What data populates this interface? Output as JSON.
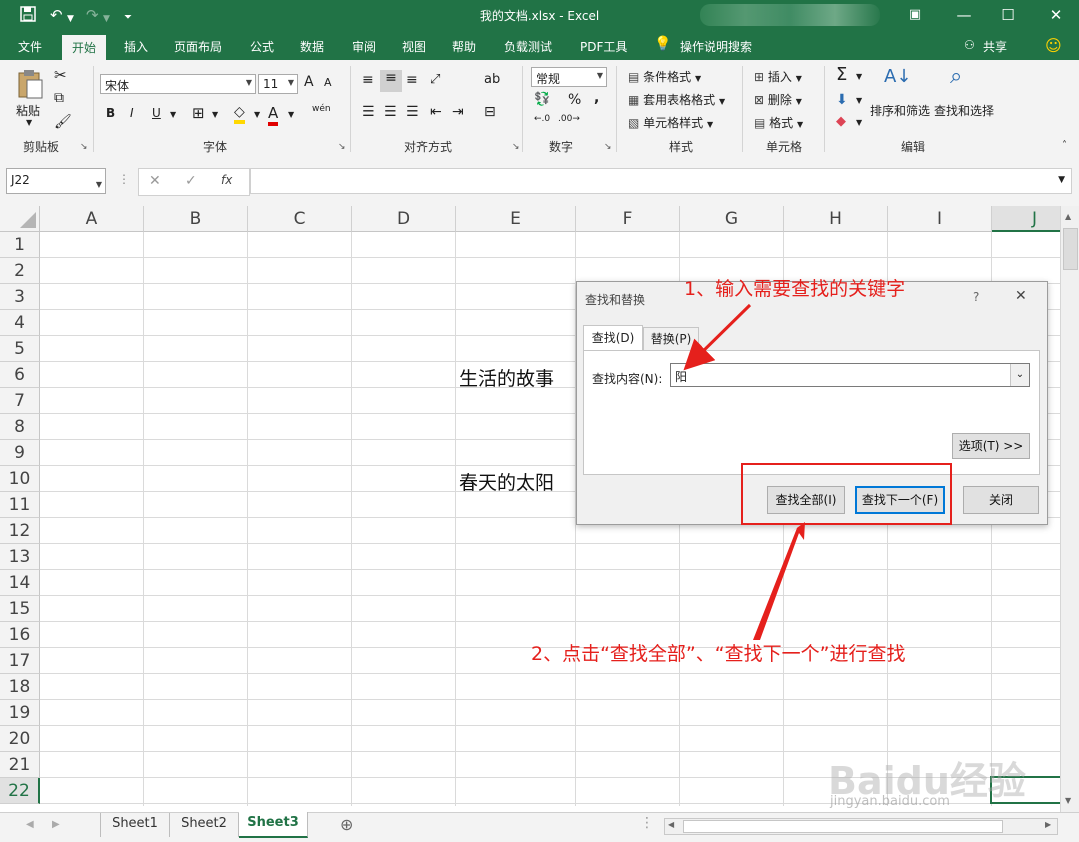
{
  "titlebar": {
    "title": "我的文档.xlsx  -  Excel",
    "save_icon": "save-icon",
    "undo_icon": "undo-icon",
    "redo_icon": "redo-icon",
    "qat_customize_icon": "chevron-down-icon",
    "ribbon_display_icon": "ribbon-display-icon",
    "minimize_glyph": "—",
    "maximize_glyph": "☐",
    "close_glyph": "✕"
  },
  "tabs": [
    "文件",
    "开始",
    "插入",
    "页面布局",
    "公式",
    "数据",
    "审阅",
    "视图",
    "帮助",
    "负载测试",
    "PDF工具",
    "操作说明搜索"
  ],
  "active_tab": "开始",
  "share_label": "共享",
  "ribbon": {
    "clipboard": {
      "paste": "粘贴",
      "label": "剪贴板"
    },
    "font": {
      "name": "宋体",
      "size": "11",
      "label": "字体",
      "bold": "B",
      "italic": "I",
      "underline": "U",
      "grow": "A",
      "shrink": "A",
      "font_color": "A",
      "wen": "wén"
    },
    "alignment": {
      "label": "对齐方式",
      "wrap": "ab"
    },
    "number": {
      "format": "常规",
      "label": "数字",
      "percent": "%",
      "comma": ","
    },
    "styles": {
      "conditional": "条件格式",
      "table": "套用表格格式",
      "cell_styles": "单元格样式",
      "label": "样式"
    },
    "cells": {
      "insert": "插入",
      "delete": "删除",
      "format": "格式",
      "label": "单元格"
    },
    "editing": {
      "sort": "排序和筛选",
      "find": "查找和选择",
      "label": "编辑"
    }
  },
  "formula_bar": {
    "name_box": "J22",
    "fx": "fx",
    "value": ""
  },
  "columns": [
    "A",
    "B",
    "C",
    "D",
    "E",
    "F",
    "G",
    "H",
    "I",
    "J"
  ],
  "rows": [
    "1",
    "2",
    "3",
    "4",
    "5",
    "6",
    "7",
    "8",
    "9",
    "10",
    "11",
    "12",
    "13",
    "14",
    "15",
    "16",
    "17",
    "18",
    "19",
    "20",
    "21",
    "22"
  ],
  "cells": {
    "E6": "生活的故事",
    "E10": "春天的太阳"
  },
  "sheets": [
    "Sheet1",
    "Sheet2",
    "Sheet3"
  ],
  "active_sheet": "Sheet3",
  "dialog": {
    "title": "查找和替换",
    "help": "?",
    "close": "✕",
    "tab_find": "查找(D)",
    "tab_replace": "替换(P)",
    "find_label": "查找内容(N):",
    "find_value": "阳",
    "options_button": "选项(T) >>",
    "find_all_button": "查找全部(I)",
    "find_next_button": "查找下一个(F)",
    "close_button": "关闭"
  },
  "annotations": {
    "step1": "1、输入需要查找的关键字",
    "step2": "2、点击“查找全部”、“查找下一个”进行查找"
  },
  "watermark": {
    "brand": "Baidu经验",
    "url": "jingyan.baidu.com"
  },
  "colors": {
    "excel_green": "#217346",
    "annotation_red": "#e5201c",
    "dialog_bg": "#f0f0f0"
  }
}
